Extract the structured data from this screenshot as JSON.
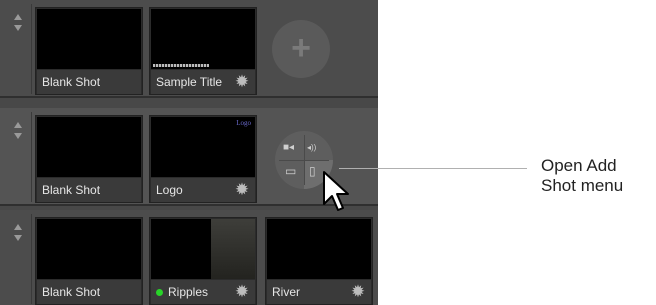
{
  "layers": [
    {
      "shots": [
        {
          "label": "Blank Shot",
          "gear": false,
          "status_dot": false,
          "thumb": "black"
        },
        {
          "label": "Sample Title",
          "gear": true,
          "status_dot": false,
          "thumb": "sample-title"
        }
      ],
      "trailing": "add-shot-button"
    },
    {
      "shots": [
        {
          "label": "Blank Shot",
          "gear": false,
          "status_dot": false,
          "thumb": "black"
        },
        {
          "label": "Logo",
          "gear": true,
          "status_dot": false,
          "thumb": "logo",
          "thumb_text": "Logo"
        }
      ],
      "trailing": "add-shot-menu"
    },
    {
      "shots": [
        {
          "label": "Blank Shot",
          "gear": false,
          "status_dot": false,
          "thumb": "black"
        },
        {
          "label": "Ripples",
          "gear": true,
          "status_dot": true,
          "thumb": "ripples"
        },
        {
          "label": "River",
          "gear": true,
          "status_dot": false,
          "thumb": "river"
        }
      ]
    }
  ],
  "add_button_symbol": "+",
  "add_shot_menu": {
    "items": [
      {
        "icon": "camera-icon",
        "symbol": "■◂"
      },
      {
        "icon": "audio-icon",
        "symbol": "◂))"
      },
      {
        "icon": "monitor-icon",
        "symbol": "▭"
      },
      {
        "icon": "document-icon",
        "symbol": "▯"
      }
    ]
  },
  "callout": {
    "line1": "Open Add",
    "line2": "Shot menu"
  },
  "colors": {
    "status_live": "#28d428",
    "panel_bg": "#484848",
    "logo_text": "#6a6acc"
  }
}
